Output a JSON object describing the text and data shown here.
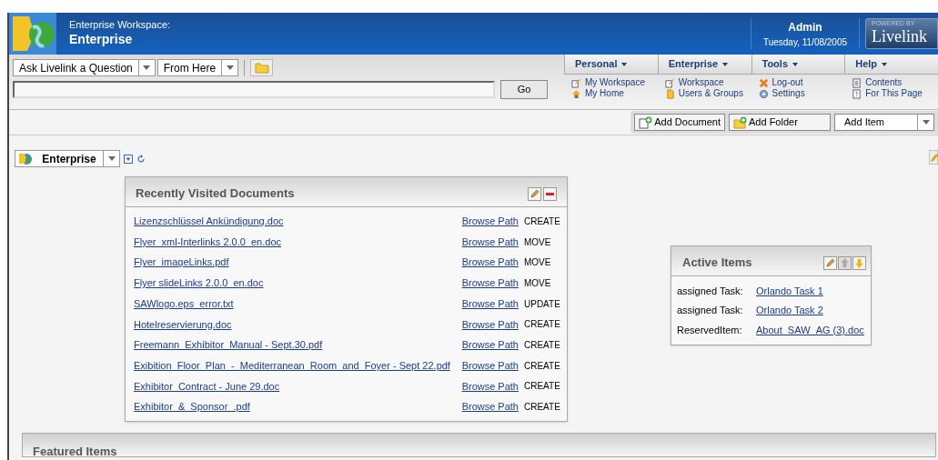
{
  "header": {
    "subtitle": "Enterprise Workspace:",
    "title": "Enterprise",
    "user": "Admin",
    "date": "Tuesday, 11/08/2005",
    "badge_top": "POWERED BY",
    "badge_name": "Livelink"
  },
  "search": {
    "scope": "Ask Livelink a Question",
    "location": "From Here",
    "go": "Go"
  },
  "menus": [
    {
      "label": "Personal",
      "items": [
        {
          "label": "My Workspace",
          "kind": "edit"
        },
        {
          "label": "My Home",
          "kind": "home"
        }
      ]
    },
    {
      "label": "Enterprise",
      "items": [
        {
          "label": "Workspace",
          "kind": "edit"
        },
        {
          "label": "Users & Groups",
          "kind": "users"
        }
      ]
    },
    {
      "label": "Tools",
      "items": [
        {
          "label": "Log-out",
          "kind": "logout"
        },
        {
          "label": "Settings",
          "kind": "gear"
        }
      ]
    },
    {
      "label": "Help",
      "items": [
        {
          "label": "Contents",
          "kind": "list"
        },
        {
          "label": "For This Page",
          "kind": "help"
        }
      ]
    }
  ],
  "actions": {
    "add_document": "Add Document",
    "add_folder": "Add Folder",
    "add_item": "Add Item"
  },
  "location": "Enterprise",
  "recent": {
    "title": "Recently Visited Documents",
    "rows": [
      {
        "name": "Lizenzschlüssel Ankündigung.doc",
        "link": "Browse Path",
        "action": "CREATE"
      },
      {
        "name": "Flyer_xml-Interlinks 2.0.0_en.doc",
        "link": "Browse Path",
        "action": "MOVE"
      },
      {
        "name": "Flyer_imageLinks.pdf",
        "link": "Browse Path",
        "action": "MOVE"
      },
      {
        "name": "Flyer slideLinks 2.0.0_en.doc",
        "link": "Browse Path",
        "action": "MOVE"
      },
      {
        "name": "SAWlogo.eps_error.txt",
        "link": "Browse Path",
        "action": "UPDATE"
      },
      {
        "name": "Hotelreservierung.doc",
        "link": "Browse Path",
        "action": "CREATE"
      },
      {
        "name": "Freemann_Exhibitor_Manual - Sept.30.pdf",
        "link": "Browse Path",
        "action": "CREATE"
      },
      {
        "name": "Exibition_Floor_Plan_-_Mediterranean_Room_and_Foyer - Sept 22.pdf",
        "link": "Browse Path",
        "action": "CREATE"
      },
      {
        "name": "Exhibitor_Contract - June 29.doc",
        "link": "Browse Path",
        "action": "CREATE"
      },
      {
        "name": "Exhibitor_&_Sponsor_.pdf",
        "link": "Browse Path",
        "action": "CREATE"
      }
    ]
  },
  "active": {
    "title": "Active Items",
    "rows": [
      {
        "label": "assigned Task:",
        "link": "Orlando Task 1"
      },
      {
        "label": "assigned Task:",
        "link": "Orlando Task 2"
      },
      {
        "label": "ReservedItem:",
        "link": "About_SAW_AG (3).doc"
      }
    ]
  },
  "featured": {
    "title": "Featured Items"
  }
}
